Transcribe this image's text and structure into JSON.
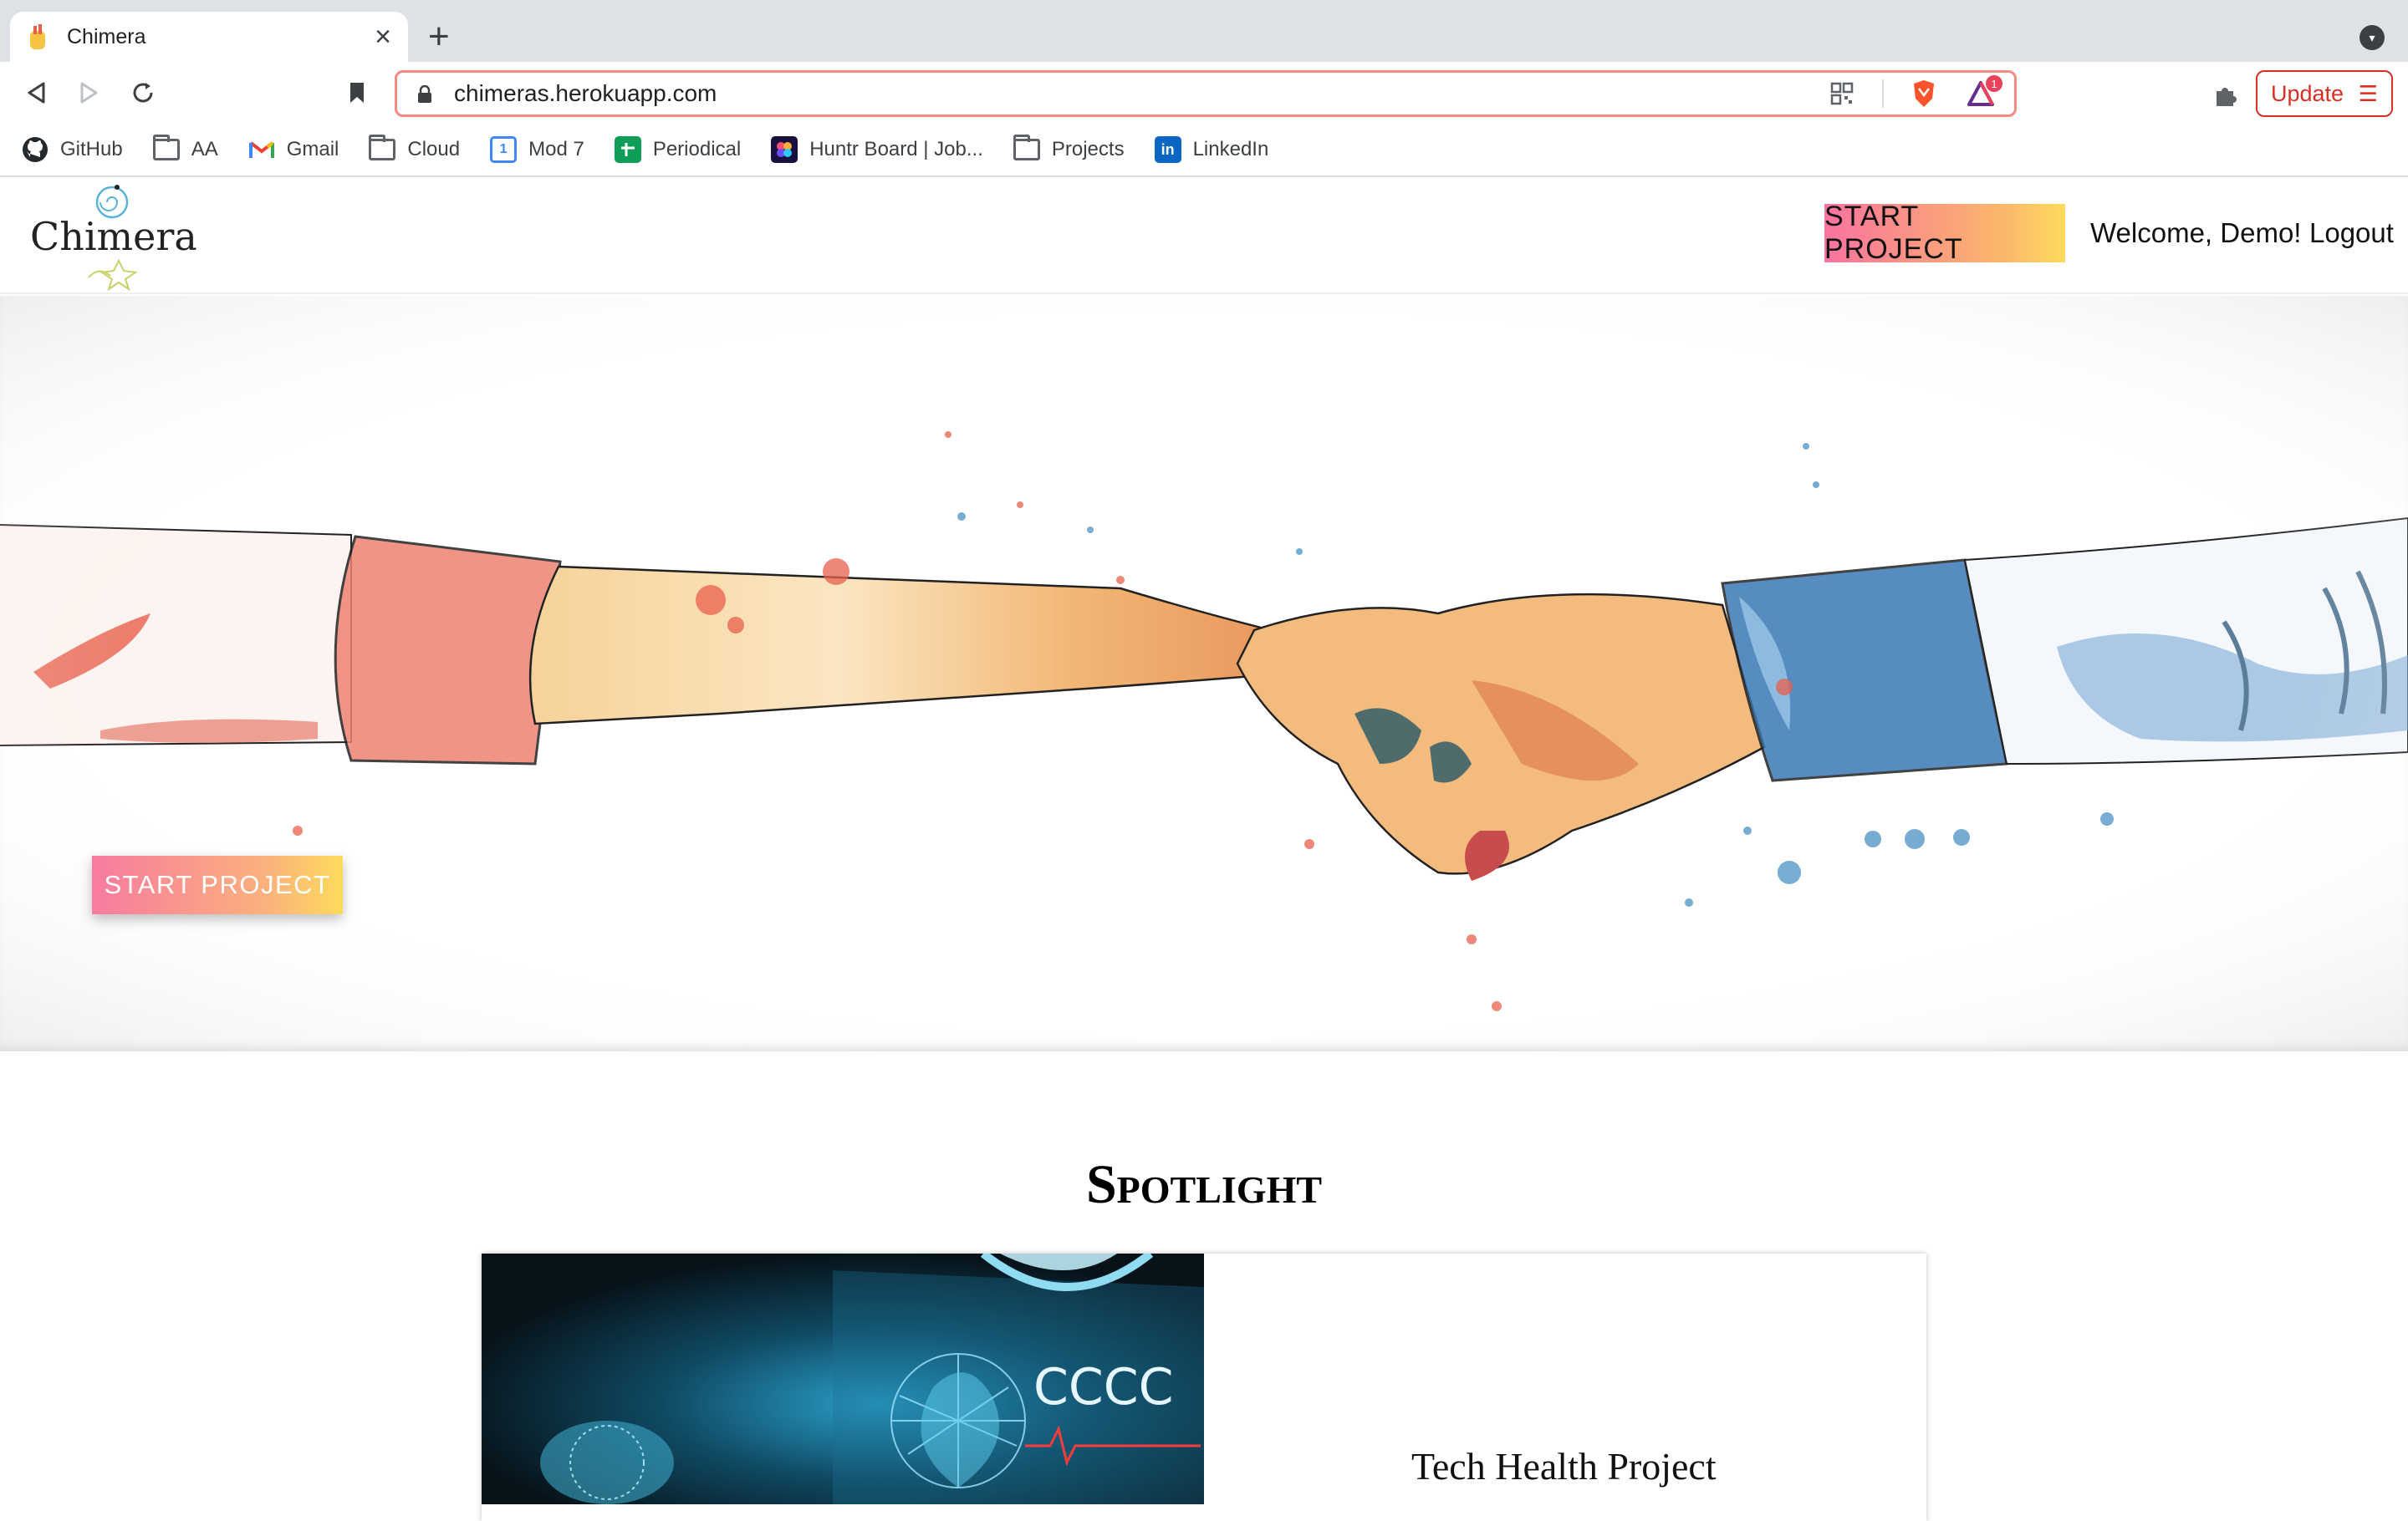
{
  "browser": {
    "tab_title": "Chimera",
    "url": "chimeras.herokuapp.com",
    "update_label": "Update",
    "bookmarks": [
      {
        "label": "GitHub",
        "icon": "github-icon"
      },
      {
        "label": "AA",
        "icon": "folder-icon"
      },
      {
        "label": "Gmail",
        "icon": "gmail-icon"
      },
      {
        "label": "Cloud",
        "icon": "folder-icon"
      },
      {
        "label": "Mod 7",
        "icon": "calendar-icon"
      },
      {
        "label": "Periodical",
        "icon": "sheets-icon"
      },
      {
        "label": "Huntr Board | Job...",
        "icon": "huntr-icon"
      },
      {
        "label": "Projects",
        "icon": "folder-icon"
      },
      {
        "label": "LinkedIn",
        "icon": "linkedin-icon"
      }
    ],
    "brave_badge": "1"
  },
  "header": {
    "logo_text": "Chimera",
    "start_project": "START PROJECT",
    "welcome": "Welcome, Demo!",
    "logout": "Logout"
  },
  "hero": {
    "start_project": "START PROJECT"
  },
  "spotlight": {
    "title": "Spotlight",
    "card_title": "Tech Health Project",
    "screen_glyphs": "CCCC"
  },
  "colors": {
    "accent_pink": "#f9739f",
    "accent_yellow": "#fddb5c",
    "update_red": "#d93025"
  }
}
